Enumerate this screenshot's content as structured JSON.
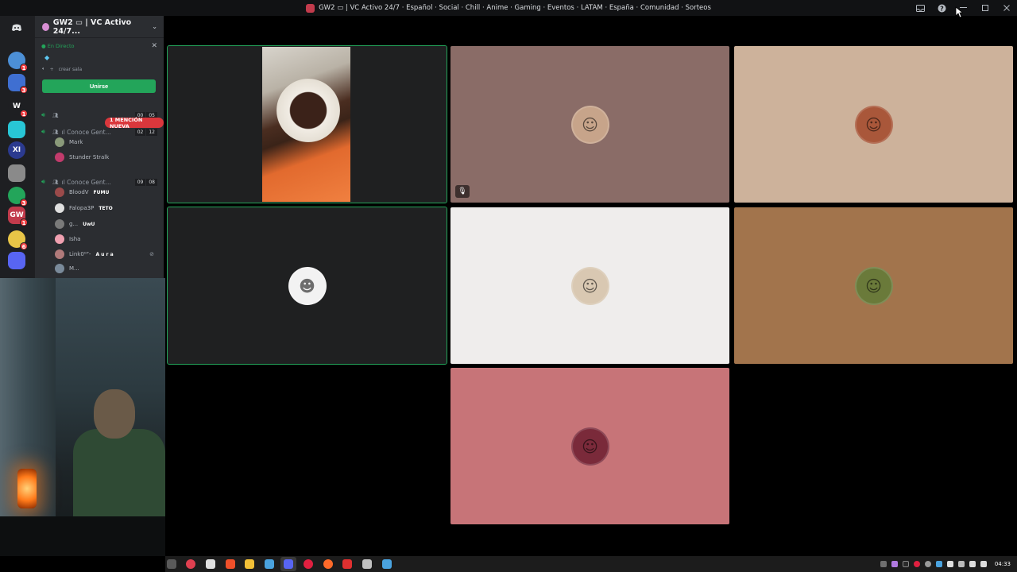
{
  "window": {
    "title": "GW2 ▭ | VC Activo 24/7 · Español · Social · Chill · Anime · Gaming · Eventos · LATAM · España · Comunidad · Sorteos"
  },
  "server": {
    "name": "GW2 ▭ | VC Activo 24/7...",
    "live_label": "En Directo",
    "create_room_label": "crear sala",
    "join_label": "Unirse",
    "mention_label": "1 MENCIÓN NUEVA"
  },
  "rail": [
    {
      "label": "",
      "color": "#5865f2",
      "badge": ""
    },
    {
      "label": "",
      "color": "#4c8fd6",
      "badge": "1"
    },
    {
      "label": "",
      "color": "#3f6fd1",
      "badge": "3"
    },
    {
      "label": "W",
      "color": "#1e1f22",
      "badge": "1"
    },
    {
      "label": "",
      "color": "#28c6d6",
      "badge": ""
    },
    {
      "label": "XI",
      "color": "#2b3a8f",
      "badge": ""
    },
    {
      "label": "",
      "color": "#8a8a8a",
      "badge": ""
    },
    {
      "label": "",
      "color": "#23a55a",
      "badge": "3"
    },
    {
      "label": "GW",
      "color": "#c23b4c",
      "badge": "1"
    },
    {
      "label": "",
      "color": "#e8c547",
      "badge": "6"
    },
    {
      "label": "",
      "color": "#5865f2",
      "badge": ""
    }
  ],
  "channels": [
    {
      "name": "",
      "counts": [
        "00",
        "05"
      ]
    },
    {
      "name": "ıl Conoce Gent...",
      "counts": [
        "02",
        "12"
      ]
    },
    {
      "name": "ıl Conoce Gent...",
      "counts": [
        "09",
        "08"
      ]
    }
  ],
  "members_a": [
    {
      "name": "Mark",
      "tag": "",
      "color": "#8a9a7a"
    },
    {
      "name": "Stunder Stralk",
      "tag": "",
      "color": "#c23b6c"
    }
  ],
  "members_b": [
    {
      "name": "BloodV",
      "tag": "FUMU",
      "color": "#9a4a4a"
    },
    {
      "name": "Falopa3P",
      "tag": "TETO",
      "color": "#e0e0e0"
    },
    {
      "name": "g...",
      "tag": "UwU",
      "color": "#7a7a7a"
    },
    {
      "name": "Isha",
      "tag": "",
      "color": "#f0a0b0"
    },
    {
      "name": "Link0ᴳᵀ-",
      "tag": "A u r a",
      "color": "#b07a7a"
    },
    {
      "name": "M...",
      "tag": "",
      "color": "#7a8a9a"
    }
  ],
  "tiles": [
    {
      "bg": "#1f2021",
      "avatar_color": "",
      "glyph": ""
    },
    {
      "bg": "#8a6c67",
      "avatar_color": "#c7a48a",
      "glyph": "☺"
    },
    {
      "bg": "#cdb29b",
      "avatar_color": "#a9573a",
      "glyph": "☺"
    },
    {
      "bg": "#1f2021",
      "avatar_color": "#f2f2f2",
      "glyph": "☻"
    },
    {
      "bg": "#efedec",
      "avatar_color": "#d9c8b2",
      "glyph": "☺"
    },
    {
      "bg": "#a2744c",
      "avatar_color": "#6a7a3a",
      "glyph": "☺"
    },
    {
      "bg": "#c77478",
      "avatar_color": "#7a2a3a",
      "glyph": "☺"
    }
  ],
  "taskbar": {
    "time": "04:33",
    "apps": [
      "#5a5a5a",
      "#e04050",
      "#e0e0e0",
      "#f0502a",
      "#f2c037",
      "#4aa3df",
      "#5865f2",
      "#e02040",
      "#ff6a2a",
      "#e03030",
      "#c0c0c0",
      "#4aa3df"
    ]
  }
}
